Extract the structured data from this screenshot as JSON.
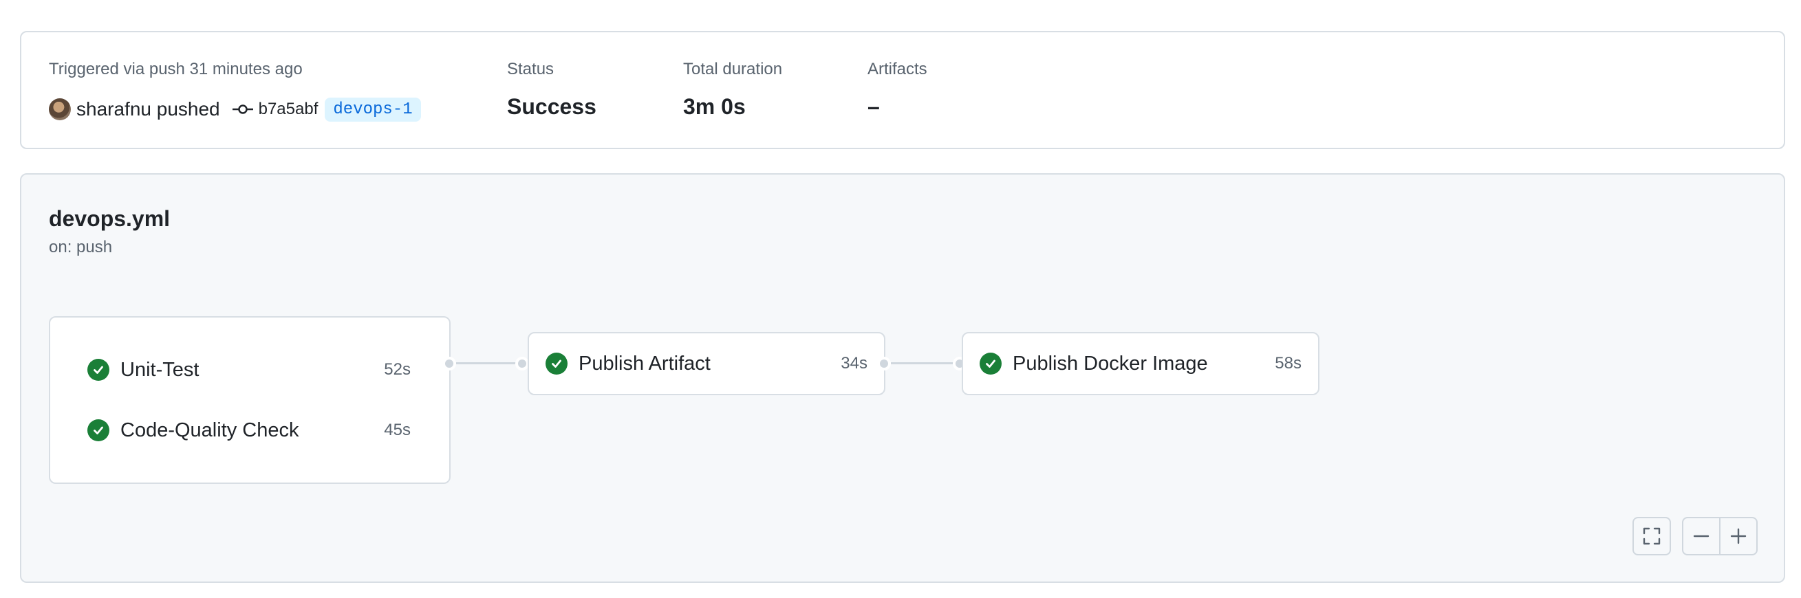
{
  "summary": {
    "trigger_label": "Triggered via push 31 minutes ago",
    "actor_text": "sharafnu pushed",
    "commit_sha": "b7a5abf",
    "branch": "devops-1",
    "status_label": "Status",
    "status_value": "Success",
    "duration_label": "Total duration",
    "duration_value": "3m 0s",
    "artifacts_label": "Artifacts",
    "artifacts_value": "–"
  },
  "workflow": {
    "file_name": "devops.yml",
    "trigger": "on: push",
    "jobs": [
      {
        "name": "Unit-Test",
        "duration": "52s",
        "status": "success"
      },
      {
        "name": "Code-Quality Check",
        "duration": "45s",
        "status": "success"
      },
      {
        "name": "Publish Artifact",
        "duration": "34s",
        "status": "success"
      },
      {
        "name": "Publish Docker Image",
        "duration": "58s",
        "status": "success"
      }
    ]
  },
  "controls": {
    "icons": [
      "fullscreen-icon",
      "zoom-out-icon",
      "zoom-in-icon"
    ]
  },
  "colors": {
    "success": "#1a7f37",
    "branch_text": "#0969da",
    "branch_bg": "#ddf4ff",
    "panel_bg": "#f6f8fa"
  }
}
